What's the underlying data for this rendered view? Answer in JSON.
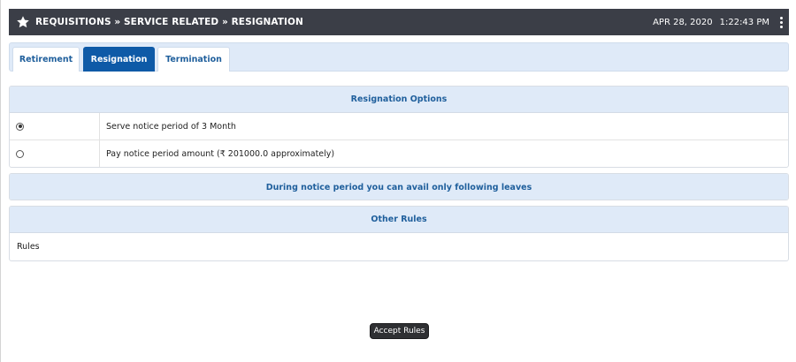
{
  "header": {
    "breadcrumb": "REQUISITIONS » SERVICE RELATED » RESIGNATION",
    "date": "APR 28, 2020",
    "time": "1:22:43 PM",
    "icon": "star-icon",
    "menu_icon": "kebab-menu-icon",
    "background_color": "#3b3e47"
  },
  "tabs": [
    {
      "label": "Retirement",
      "active": false
    },
    {
      "label": "Resignation",
      "active": true
    },
    {
      "label": "Termination",
      "active": false
    }
  ],
  "resignation_options": {
    "title": "Resignation Options",
    "options": [
      {
        "label": "Serve notice period of 3 Month",
        "selected": true
      },
      {
        "label": "Pay notice period amount (₹ 201000.0 approximately)",
        "selected": false
      }
    ]
  },
  "leaves_panel": {
    "title": "During notice period you can avail only following leaves"
  },
  "other_rules": {
    "title": "Other Rules",
    "body": "Rules"
  },
  "accept_button": {
    "label": "Accept Rules"
  },
  "colors": {
    "accent": "#0e5aa7",
    "panel_head": "#dfeaf8",
    "heading_text": "#1f5f9c"
  }
}
